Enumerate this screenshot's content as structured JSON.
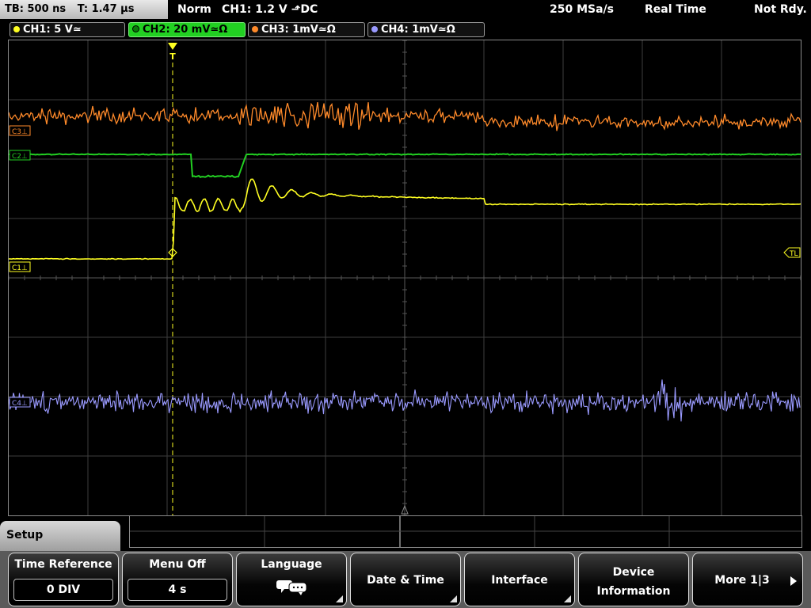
{
  "topbar": {
    "timebase": "TB: 500 ns",
    "trigger_pos": "T: 1.47 µs",
    "trigger_mode": "Norm",
    "trigger_source": "CH1: 1.2 V ⬏DC",
    "sample_rate": "250 MSa/s",
    "acq_mode": "Real Time",
    "status": "Not Rdy."
  },
  "channels": [
    {
      "label": "CH1: 5 V≃",
      "color": "#ffff22"
    },
    {
      "label": "CH2: 20 mV≃Ω",
      "color": "#22d022"
    },
    {
      "label": "CH3: 1mV≃Ω",
      "color": "#ff8a2a"
    },
    {
      "label": "CH4: 1mV≃Ω",
      "color": "#9a9aff"
    }
  ],
  "markers": {
    "c3": "C3⊥",
    "c2": "C2⊥",
    "c1": "C1⊥",
    "c4": "C4⊥",
    "tl": "TL",
    "trigger": "T"
  },
  "menu": {
    "setup": "Setup",
    "time_reference_label": "Time Reference",
    "time_reference_value": "0 DIV",
    "menu_off_label": "Menu Off",
    "menu_off_value": "4 s",
    "language": "Language",
    "date_time": "Date & Time",
    "interface": "Interface",
    "device_line1": "Device",
    "device_line2": "Information",
    "more": "More 1|3"
  },
  "colors": {
    "ch1": "#ffff22",
    "ch2": "#22d022",
    "ch3": "#ff8a2a",
    "ch4": "#9a9aff",
    "grid": "#3e3e3e"
  }
}
